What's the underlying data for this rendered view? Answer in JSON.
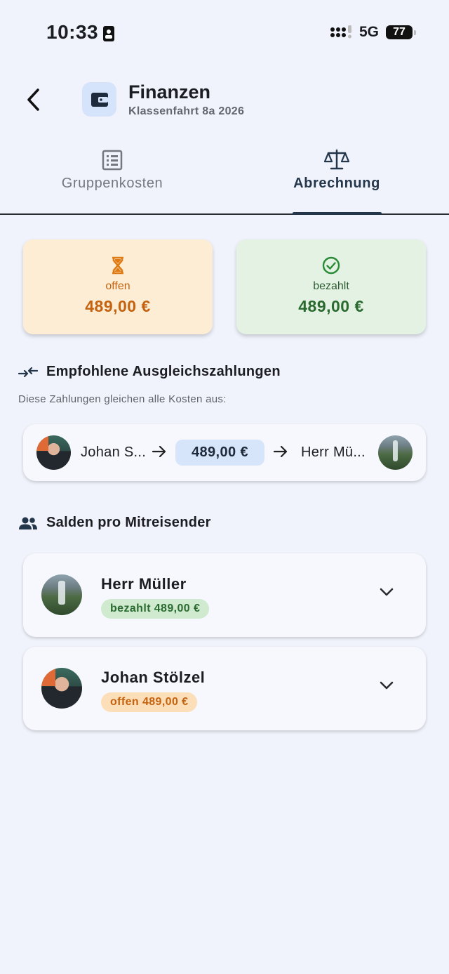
{
  "status_bar": {
    "time": "10:33",
    "network": "5G",
    "battery": "77"
  },
  "header": {
    "title": "Finanzen",
    "subtitle": "Klassenfahrt 8a 2026"
  },
  "tabs": [
    {
      "label": "Gruppenkosten",
      "icon": "list-icon",
      "active": false
    },
    {
      "label": "Abrechnung",
      "icon": "scale-icon",
      "active": true
    }
  ],
  "summary": {
    "open": {
      "label": "offen",
      "amount": "489,00 €",
      "icon": "hourglass-icon",
      "color": "#c4620f"
    },
    "paid": {
      "label": "bezahlt",
      "amount": "489,00 €",
      "icon": "check-circle-icon",
      "color": "#2a6a2f"
    }
  },
  "payments_section": {
    "title": "Empfohlene Ausgleichszahlungen",
    "description": "Diese Zahlungen gleichen alle Kosten aus:",
    "items": [
      {
        "from": "Johan S...",
        "amount": "489,00 €",
        "to": "Herr Mü..."
      }
    ]
  },
  "balances_section": {
    "title": "Salden pro Mitreisender",
    "people": [
      {
        "name": "Herr Müller",
        "status": "bezahlt 489,00 €",
        "state": "paid"
      },
      {
        "name": "Johan Stölzel",
        "status": "offen 489,00 €",
        "state": "open"
      }
    ]
  }
}
